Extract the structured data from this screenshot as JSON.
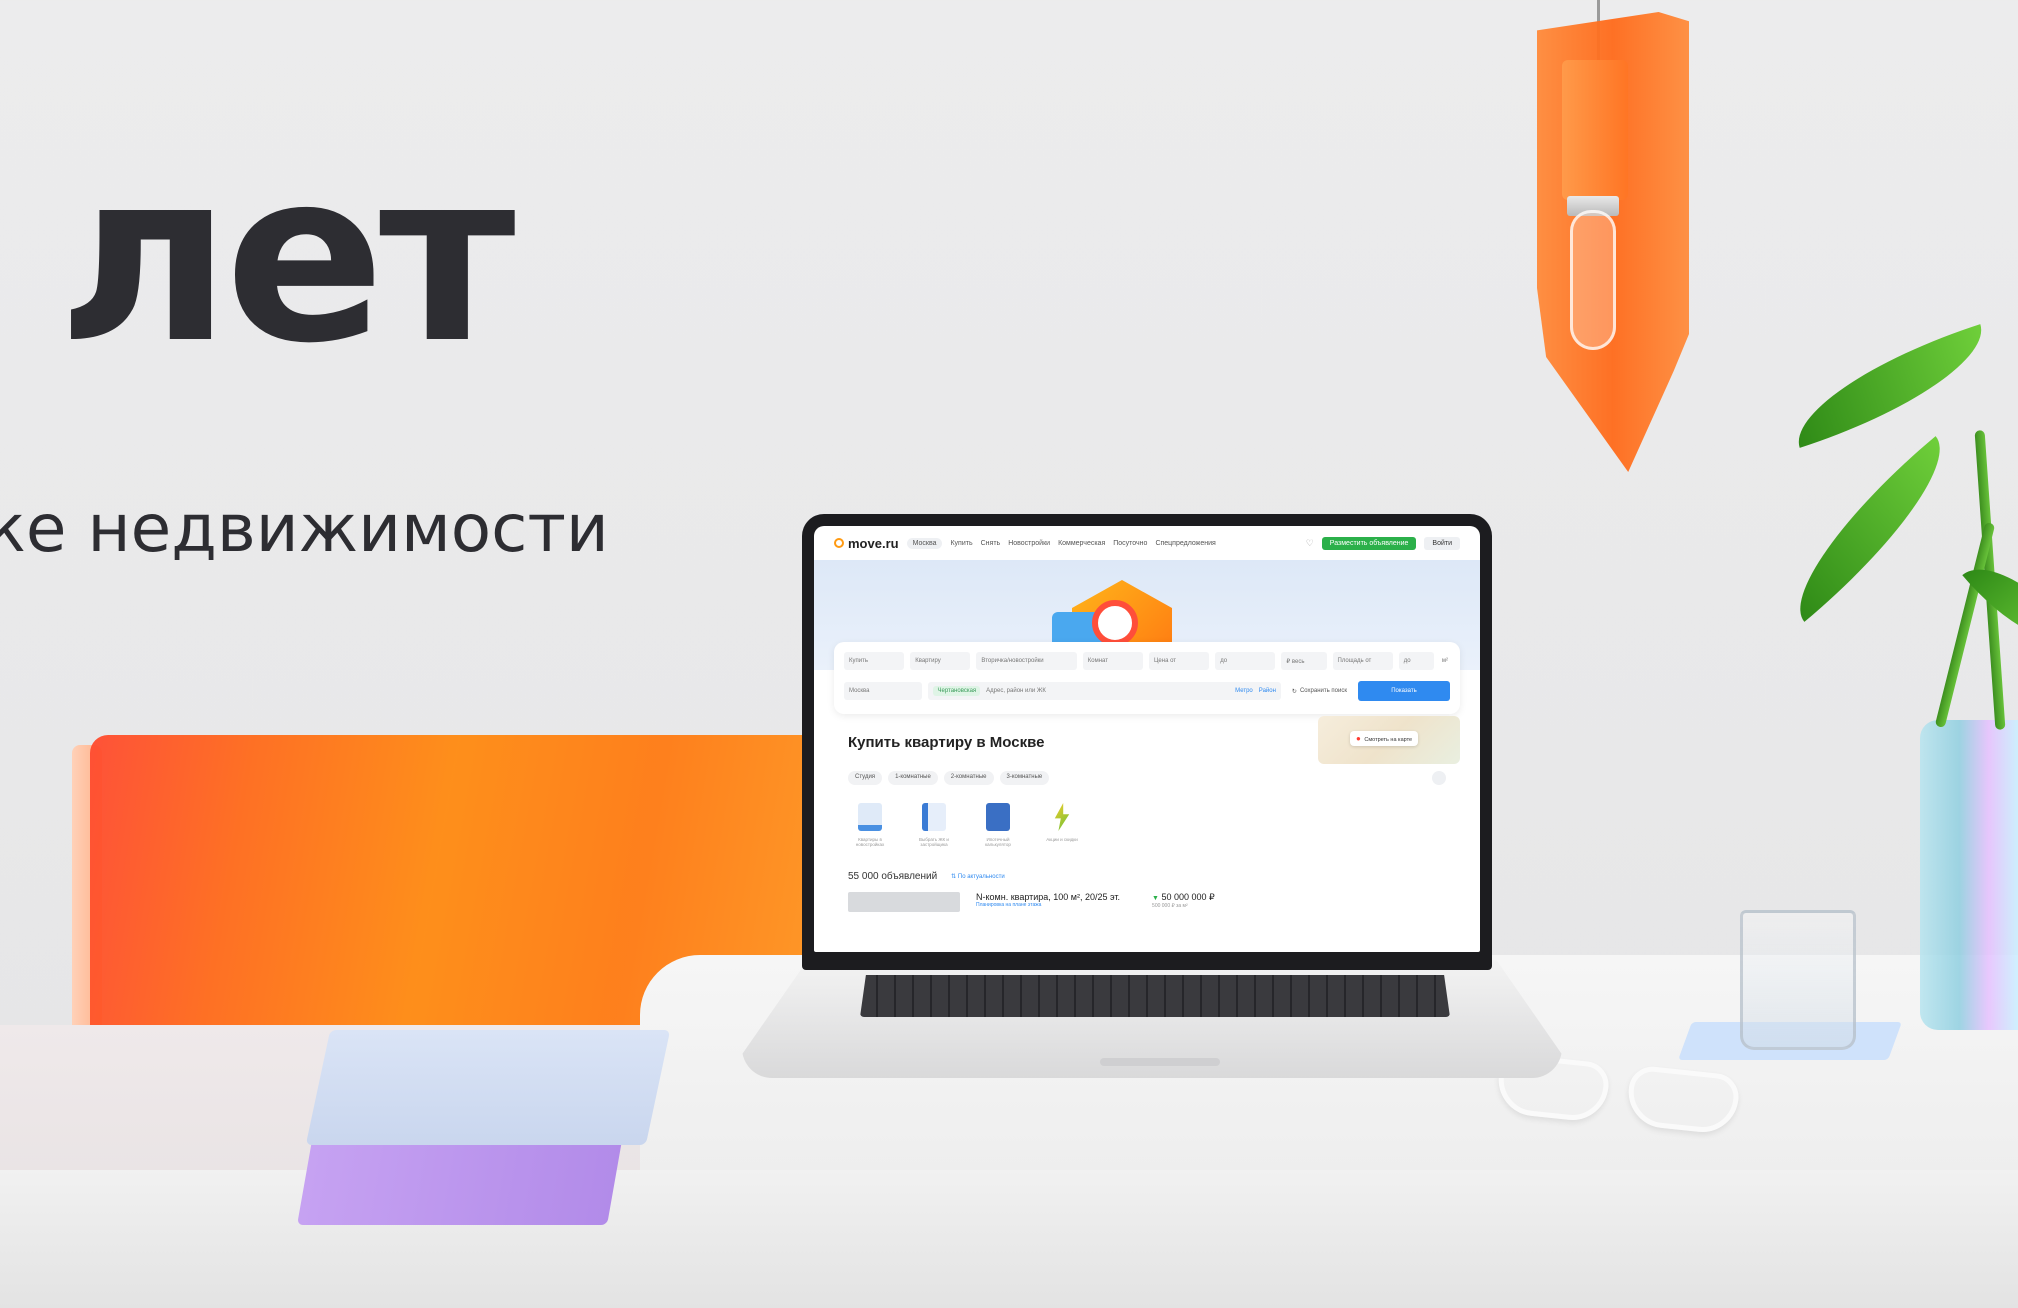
{
  "headline": {
    "main": "лет",
    "sub": "ке недвижимости"
  },
  "screen": {
    "nav": {
      "logo": "move.ru",
      "city": "Москва",
      "links": [
        "Купить",
        "Снять",
        "Новостройки",
        "Коммерческая",
        "Посуточно",
        "Спецпредложения"
      ],
      "post_button": "Разместить объявление",
      "login_button": "Войти"
    },
    "search": {
      "deal": "Купить",
      "type": "Квартиру",
      "market": "Вторичка/новостройки",
      "rooms": "Комнат",
      "price_from": "Цена от",
      "price_to": "до",
      "currency": "₽ весь",
      "area_from": "Площадь от",
      "area_to": "до",
      "area_unit": "м²",
      "location": "Москва",
      "metro_tag": "Чертановская",
      "address_placeholder": "Адрес, район или ЖК",
      "metro_link": "Метро",
      "district_link": "Район",
      "save_search": "Сохранить поиск",
      "submit": "Показать"
    },
    "map_button": "Смотреть на карте",
    "page_title": "Купить квартиру в Москве",
    "chips": [
      "Студия",
      "1-комнатные",
      "2-комнатные",
      "3-комнатные"
    ],
    "categories": [
      "Квартиры в новостройках",
      "Выбрать ЖК и застройщика",
      "Ипотечный калькулятор",
      "Акции и скидки"
    ],
    "results_count": "55 000 объявлений",
    "sort_label": "По актуальности",
    "listing": {
      "title": "N-комн. квартира, 100 м², 20/25 эт.",
      "subtitle": "Планировка на плане этажа",
      "price": "50 000 000 ₽",
      "price_per_m": "500 000 ₽ за м²"
    }
  },
  "colors": {
    "accent_orange": "#ff7a12",
    "brand_green": "#2bb04a",
    "brand_blue": "#2f8af0",
    "text_dark": "#2d2d32"
  }
}
